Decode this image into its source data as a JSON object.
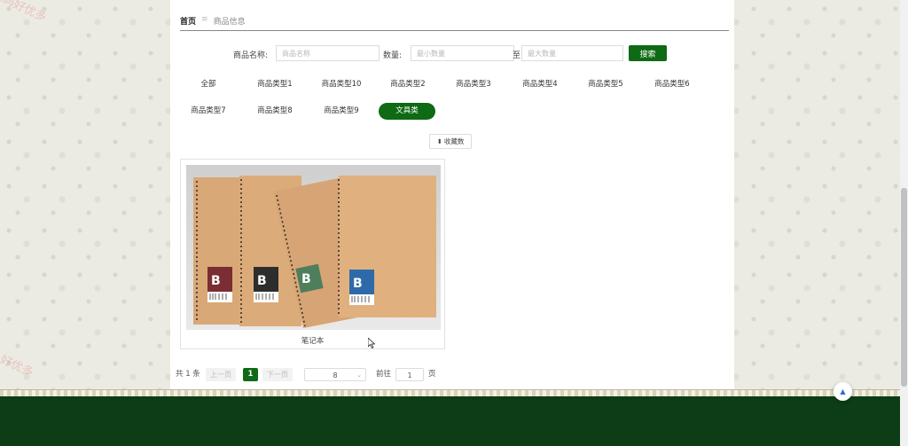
{
  "watermarks": [
    "源码好优多",
    "源码好优多",
    "源码好优多",
    "好优多"
  ],
  "breadcrumb": {
    "home": "首页",
    "separator": "≡",
    "current": "商品信息"
  },
  "search": {
    "name_label": "商品名称:",
    "name_placeholder": "商品名称",
    "qty_label": "数量:",
    "min_placeholder": "最小数量",
    "to": "至",
    "max_placeholder": "最大数量",
    "button": "搜索"
  },
  "categories": [
    "全部",
    "商品类型1",
    "商品类型10",
    "商品类型2",
    "商品类型3",
    "商品类型4",
    "商品类型5",
    "商品类型6",
    "商品类型7",
    "商品类型8",
    "商品类型9",
    "文具类"
  ],
  "active_category": "文具类",
  "sort_button": "收藏数",
  "products": [
    {
      "name": "笔记本",
      "labels": [
        "B",
        "B",
        "B",
        "B"
      ]
    }
  ],
  "pager": {
    "total": "共 1 条",
    "prev": "上一页",
    "page": "1",
    "next": "下一页",
    "page_size": "8",
    "goto": "前往",
    "goto_value": "1",
    "page_unit": "页"
  },
  "colors": {
    "accent": "#0e6a14",
    "footer": "#0c3d16"
  }
}
